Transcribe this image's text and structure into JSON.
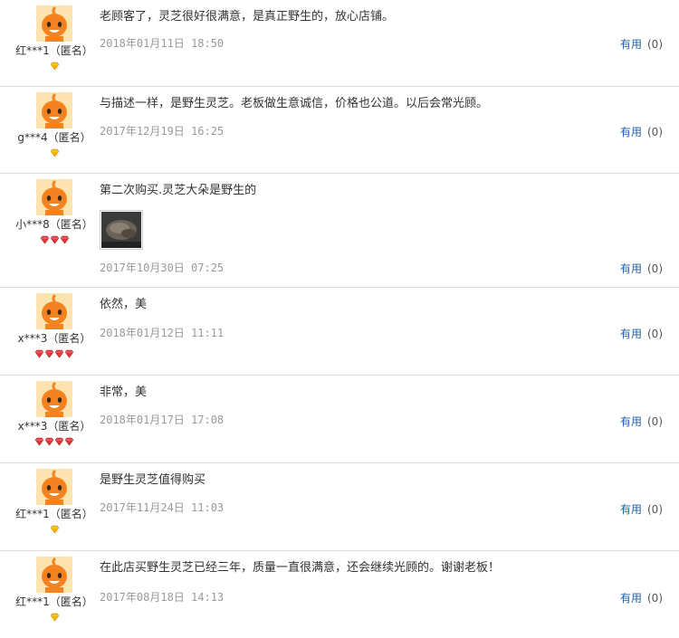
{
  "useful_label": "有用",
  "colors": {
    "link": "#1f5fa5",
    "date": "#999999",
    "gem_gold": "#f4b400",
    "gem_red": "#e2353a",
    "avatar": "#f58220"
  },
  "reviews": [
    {
      "user": "红***1（匿名）",
      "badge": "gold",
      "badge_count": 1,
      "text": "老顾客了，灵芝很好很满意，是真正野生的，放心店铺。",
      "date": "2018年01月11日 18:50",
      "useful_count": "(0)"
    },
    {
      "user": "g***4（匿名）",
      "badge": "gold",
      "badge_count": 1,
      "text": "与描述一样，是野生灵芝。老板做生意诚信，价格也公道。以后会常光顾。",
      "date": "2017年12月19日 16:25",
      "useful_count": "(0)"
    },
    {
      "user": "小***8（匿名）",
      "badge": "red",
      "badge_count": 3,
      "text": "第二次购买.灵芝大朵是野生的",
      "date": "2017年10月30日 07:25",
      "useful_count": "(0)",
      "has_photo": true
    },
    {
      "user": "x***3（匿名）",
      "badge": "red",
      "badge_count": 4,
      "text": "依然，美",
      "date": "2018年01月12日 11:11",
      "useful_count": "(0)"
    },
    {
      "user": "x***3（匿名）",
      "badge": "red",
      "badge_count": 4,
      "text": "非常，美",
      "date": "2018年01月17日 17:08",
      "useful_count": "(0)"
    },
    {
      "user": "红***1（匿名）",
      "badge": "gold",
      "badge_count": 1,
      "text": "是野生灵芝值得购买",
      "date": "2017年11月24日 11:03",
      "useful_count": "(0)"
    },
    {
      "user": "红***1（匿名）",
      "badge": "gold",
      "badge_count": 1,
      "text": "在此店买野生灵芝已经三年，质量一直很满意，还会继续光顾的。谢谢老板！",
      "date": "2017年08月18日 14:13",
      "useful_count": "(0)"
    }
  ]
}
